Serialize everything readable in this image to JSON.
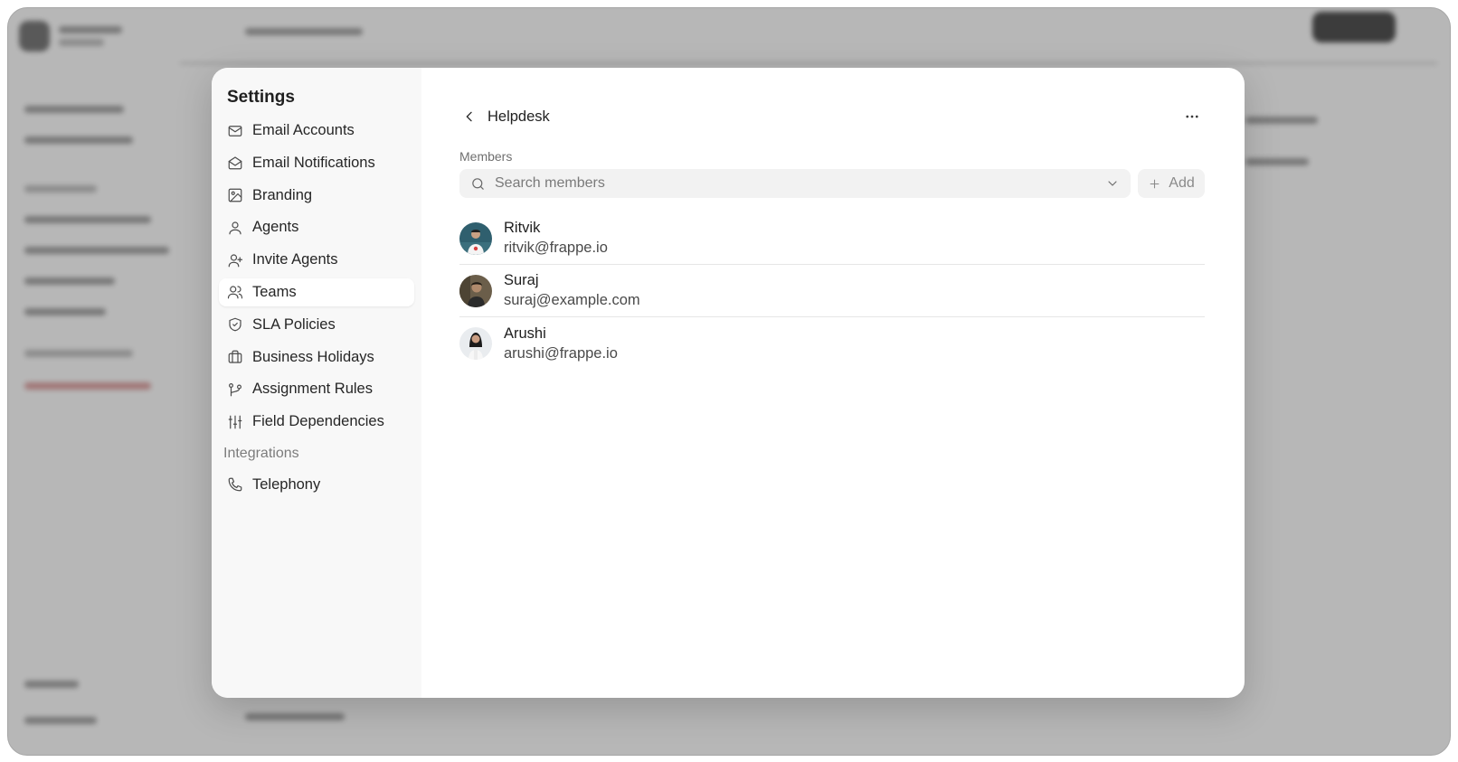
{
  "settings": {
    "title": "Settings",
    "nav_items": [
      {
        "label": "Email Accounts",
        "icon": "mail-icon"
      },
      {
        "label": "Email Notifications",
        "icon": "mail-open-icon"
      },
      {
        "label": "Branding",
        "icon": "image-icon"
      },
      {
        "label": "Agents",
        "icon": "user-icon"
      },
      {
        "label": "Invite Agents",
        "icon": "user-plus-icon"
      },
      {
        "label": "Teams",
        "icon": "users-icon",
        "active": true
      },
      {
        "label": "SLA Policies",
        "icon": "shield-check-icon"
      },
      {
        "label": "Business Holidays",
        "icon": "briefcase-icon"
      },
      {
        "label": "Assignment Rules",
        "icon": "git-branch-icon"
      },
      {
        "label": "Field Dependencies",
        "icon": "sliders-icon"
      }
    ],
    "integrations_label": "Integrations",
    "integration_items": [
      {
        "label": "Telephony",
        "icon": "phone-icon"
      }
    ]
  },
  "team": {
    "title": "Helpdesk",
    "members_label": "Members",
    "search_placeholder": "Search members",
    "add_label": "Add",
    "members": [
      {
        "name": "Ritvik",
        "email": "ritvik@frappe.io"
      },
      {
        "name": "Suraj",
        "email": "suraj@example.com"
      },
      {
        "name": "Arushi",
        "email": "arushi@frappe.io"
      }
    ]
  }
}
